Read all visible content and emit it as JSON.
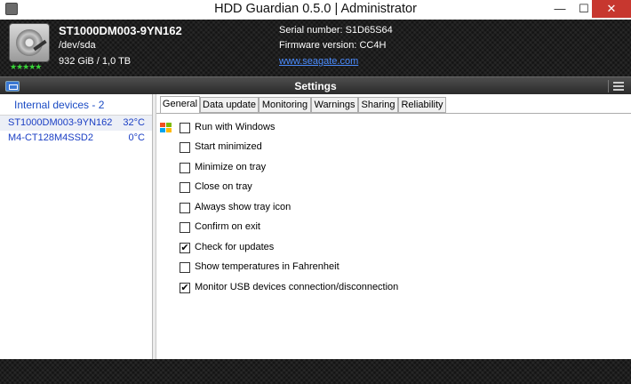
{
  "window": {
    "title": "HDD Guardian 0.5.0 | Administrator",
    "minimize": "—",
    "maximize": "☐",
    "close": "✕"
  },
  "header": {
    "model": "ST1000DM003-9YN162",
    "path": "/dev/sda",
    "capacity": "932 GiB / 1,0 TB",
    "serial": "Serial number: S1D65S64",
    "firmware": "Firmware version: CC4H",
    "website": "www.seagate.com",
    "health_stars": "★★★★★",
    "health_rating": 5,
    "icon": "hard-disk-icon"
  },
  "settings_bar": {
    "label": "Settings"
  },
  "sidebar": {
    "heading": "Internal devices - 2",
    "devices": [
      {
        "name": "ST1000DM003-9YN162",
        "temp": "32°C",
        "selected": true
      },
      {
        "name": "M4-CT128M4SSD2",
        "temp": "0°C",
        "selected": false
      }
    ]
  },
  "tabs": [
    {
      "label": "General",
      "active": true
    },
    {
      "label": "Data update",
      "active": false
    },
    {
      "label": "Monitoring",
      "active": false
    },
    {
      "label": "Warnings",
      "active": false
    },
    {
      "label": "Sharing",
      "active": false
    },
    {
      "label": "Reliability",
      "active": false
    }
  ],
  "options": [
    {
      "label": "Run with Windows",
      "checked": false
    },
    {
      "label": "Start minimized",
      "checked": false
    },
    {
      "label": "Minimize on tray",
      "checked": false
    },
    {
      "label": "Close on tray",
      "checked": false
    },
    {
      "label": "Always show tray icon",
      "checked": false
    },
    {
      "label": "Confirm on exit",
      "checked": false
    },
    {
      "label": "Check for updates",
      "checked": true
    },
    {
      "label": "Show temperatures in Fahrenheit",
      "checked": false
    },
    {
      "label": "Monitor USB devices connection/disconnection",
      "checked": true
    }
  ],
  "colors": {
    "link": "#4a8cff",
    "device_text": "#1a3ec4",
    "close_button": "#c7372f",
    "stars": "#38d438"
  }
}
